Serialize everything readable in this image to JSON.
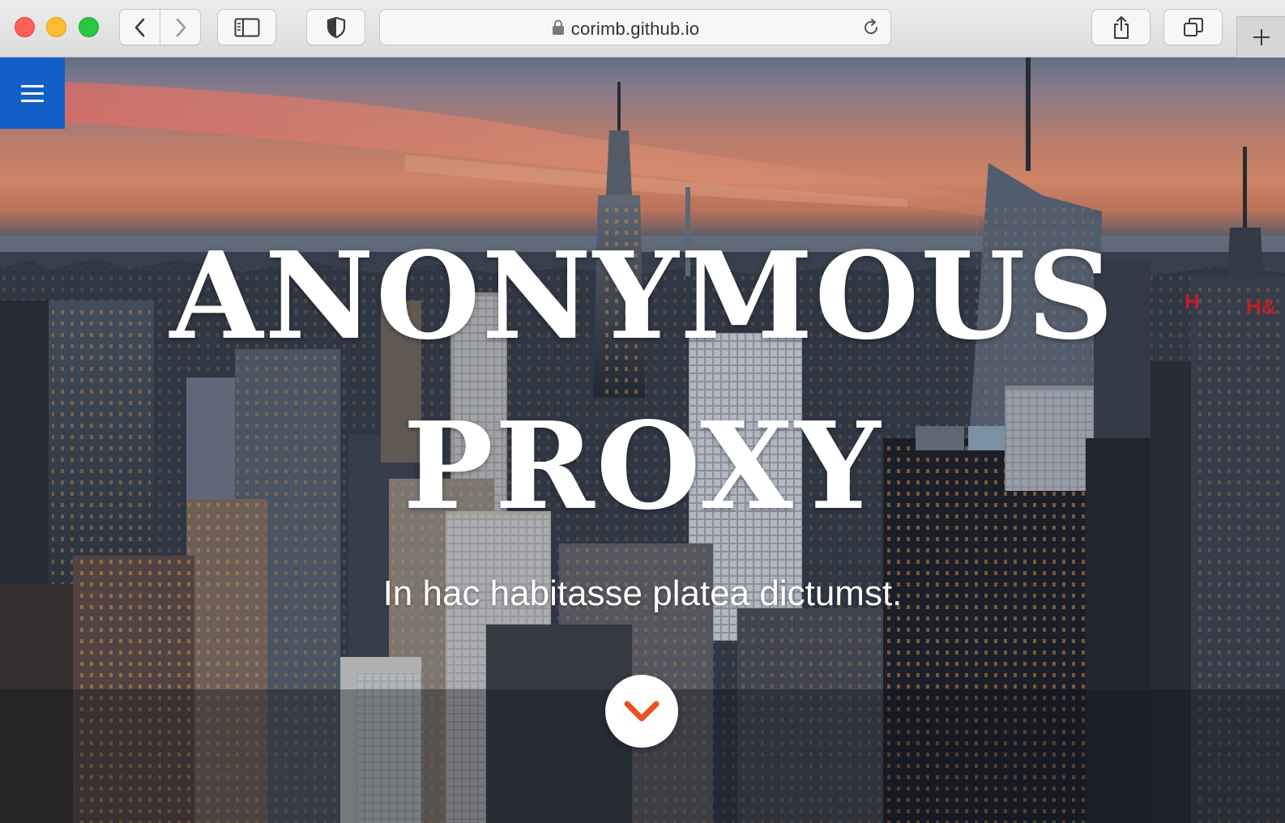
{
  "browser": {
    "url": "corimb.github.io",
    "icons": {
      "back": "chevron-left-icon",
      "forward": "chevron-right-icon",
      "sidebar": "sidebar-icon",
      "privacy": "shield-icon",
      "lock": "lock-icon",
      "reload": "reload-icon",
      "share": "share-icon",
      "tabs": "tabs-overview-icon",
      "new_tab": "plus-icon"
    }
  },
  "hero": {
    "title_line1": "ANONYMOUS",
    "title_line2": "PROXY",
    "subtitle": "In hac habitasse platea dictumst.",
    "menu_icon": "hamburger-icon",
    "scroll_icon": "chevron-down-icon",
    "colors": {
      "menu_bg": "#1260c7",
      "scroll_arrow": "#e8501e"
    }
  }
}
